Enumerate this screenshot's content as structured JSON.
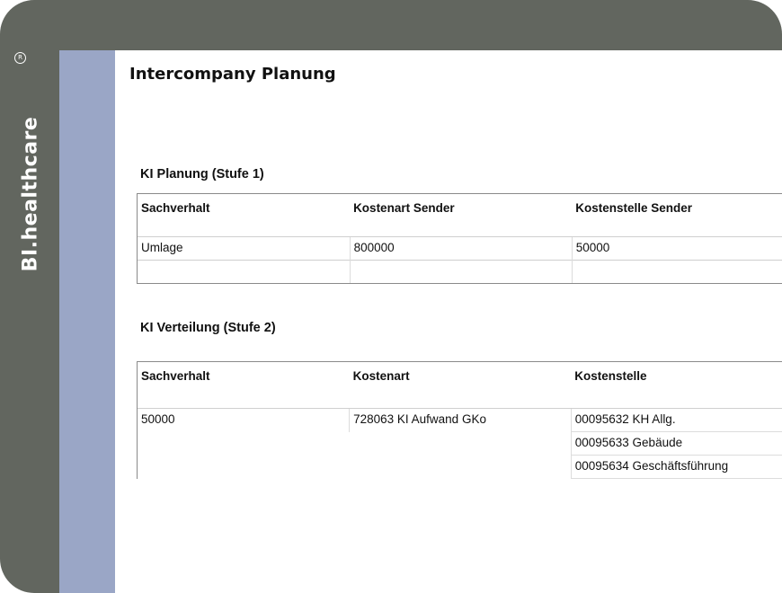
{
  "brand": {
    "name": "BI.healthcare",
    "registered_mark": "R"
  },
  "page": {
    "title": "Intercompany Planung"
  },
  "section1": {
    "title": "KI Planung (Stufe 1)",
    "columns": [
      "Sachverhalt",
      "Kostenart Sender",
      "Kostenstelle Sender"
    ],
    "rows": [
      [
        "Umlage",
        "800000",
        "50000"
      ],
      [
        "",
        "",
        ""
      ]
    ]
  },
  "section2": {
    "title": "KI Verteilung (Stufe 2)",
    "columns": [
      "Sachverhalt",
      "Kostenart",
      "Kostenstelle"
    ],
    "rows": [
      [
        "50000",
        "728063 KI Aufwand GKo",
        "00095632 KH Allg."
      ],
      [
        "",
        "",
        "00095633 Gebäude"
      ],
      [
        "",
        "",
        "00095634 Geschäftsführung"
      ]
    ]
  },
  "colors": {
    "frame": "#62665f",
    "accent_bar": "#9aa6c6",
    "content_bg": "#ffffff"
  }
}
